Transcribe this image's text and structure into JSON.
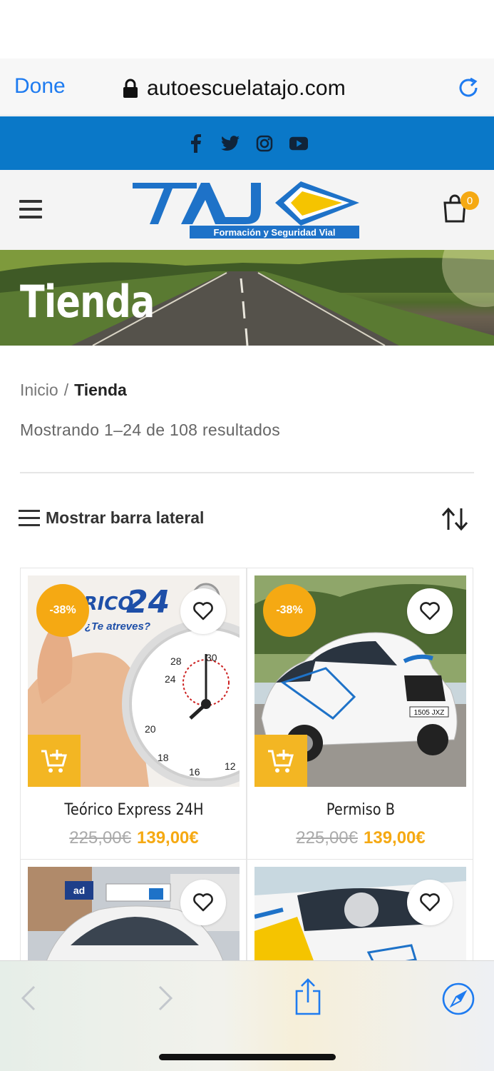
{
  "browser": {
    "done_label": "Done",
    "url": "autoescuelatajo.com"
  },
  "social": [
    "facebook-icon",
    "twitter-icon",
    "instagram-icon",
    "youtube-icon"
  ],
  "header": {
    "logo_text": "TAJO",
    "logo_tagline": "Formación y Seguridad Vial",
    "cart_count": "0"
  },
  "hero": {
    "title": "Tienda"
  },
  "breadcrumb": {
    "home": "Inicio",
    "separator": "/",
    "current": "Tienda"
  },
  "results_text": "Mostrando 1–24 de 108 resultados",
  "sidebar_toggle_label": "Mostrar barra lateral",
  "products": [
    {
      "title": "Teórico Express 24H",
      "old_price": "225,00€",
      "new_price": "139,00€",
      "badge": "-38%"
    },
    {
      "title": "Permiso B",
      "old_price": "225,00€",
      "new_price": "139,00€",
      "badge": "-38%"
    },
    {
      "title": "",
      "old_price": "",
      "new_price": "",
      "badge": ""
    },
    {
      "title": "",
      "old_price": "",
      "new_price": "",
      "badge": ""
    }
  ],
  "product_images": {
    "p1": {
      "top_text": "TEÓRICO",
      "brand_number": "24",
      "tagline": "¿Te atreves?"
    },
    "p2": {
      "plate": "1505 JXZ"
    },
    "p3": {
      "sign": "ad"
    }
  },
  "colors": {
    "accent": "#f5a913",
    "social_bar": "#0a78c8",
    "safari_blue": "#1e7bf0"
  }
}
